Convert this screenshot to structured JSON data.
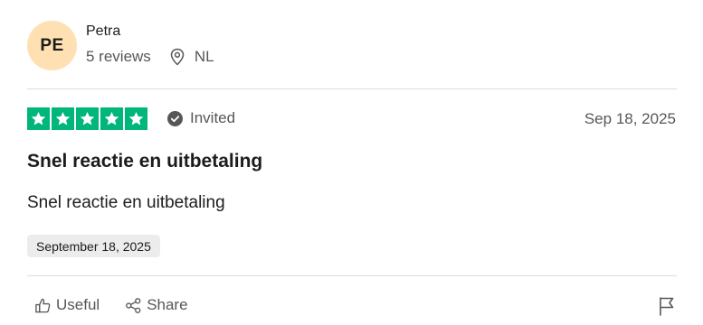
{
  "reviewer": {
    "initials": "PE",
    "name": "Petra",
    "review_count": "5 reviews",
    "country": "NL",
    "avatar_color": "#ffe0b2"
  },
  "review": {
    "rating": 5,
    "max_rating": 5,
    "star_color": "#00b67a",
    "status": "Invited",
    "date_short": "Sep 18, 2025",
    "title": "Snel reactie en uitbetaling",
    "body": "Snel reactie en uitbetaling",
    "experience_date": "September 18, 2025"
  },
  "actions": {
    "useful_label": "Useful",
    "share_label": "Share"
  },
  "icons": [
    "location-pin-icon",
    "check-circle-icon",
    "thumbs-up-icon",
    "share-icon",
    "flag-icon",
    "star-icon"
  ]
}
